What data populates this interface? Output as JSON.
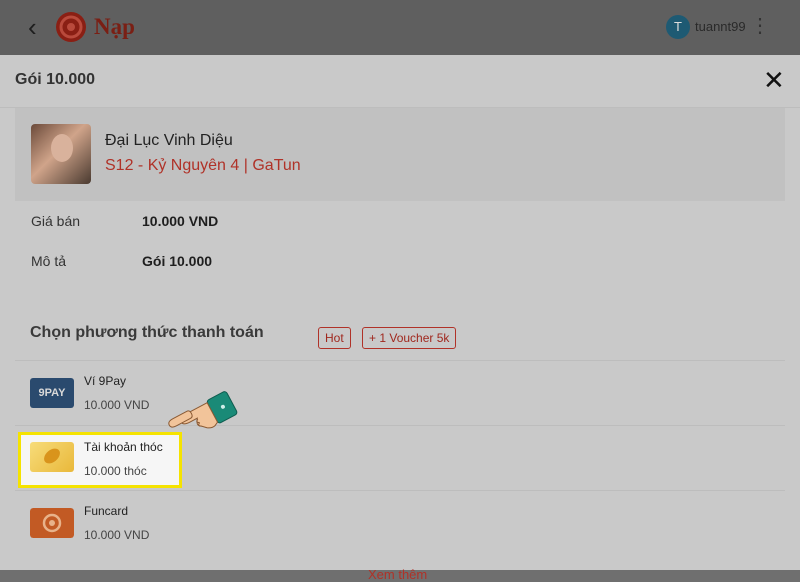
{
  "header": {
    "app_title": "Nạp",
    "avatar_initial": "T",
    "username": "tuannt99"
  },
  "modal": {
    "title": "Gói 10.000",
    "game": {
      "name": "Đại Lục Vinh Diệu",
      "server": "S12 - Kỷ Nguyên 4 | GaTun"
    },
    "info": [
      {
        "label": "Giá bán",
        "value": "10.000 VND"
      },
      {
        "label": "Mô tả",
        "value": "Gói 10.000"
      }
    ],
    "payment_section_title": "Chọn phương thức thanh toán",
    "payment_methods": [
      {
        "name": "Ví 9Pay",
        "price": "10.000 VND",
        "logo_text": "9PAY",
        "badges": [
          "Hot",
          "+ 1 Voucher 5k"
        ]
      },
      {
        "name": "Tài khoản thóc",
        "price": "10.000 thóc",
        "highlighted": true
      },
      {
        "name": "Funcard",
        "price": "10.000 VND"
      }
    ],
    "more_label": "Xem thêm"
  },
  "colors": {
    "accent": "#b03228",
    "highlight_border": "#f5e300",
    "cursor_hand": "#f2c49a",
    "cursor_cuff": "#1a8a77"
  }
}
